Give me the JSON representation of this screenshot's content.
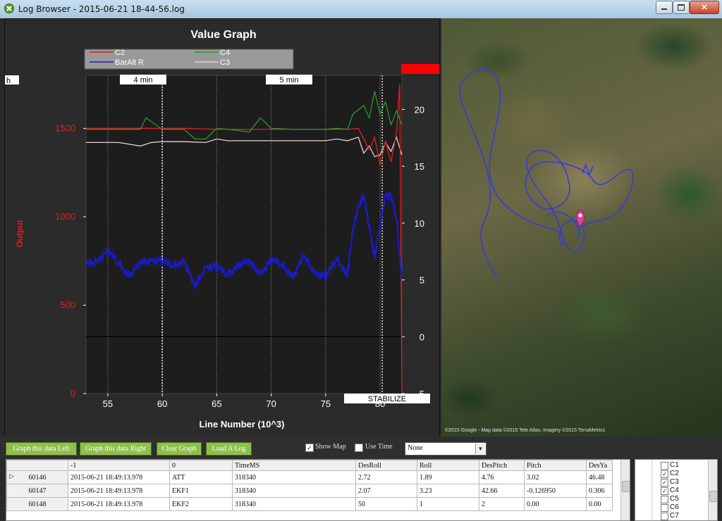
{
  "window": {
    "title": "Log Browser - 2015-06-21 18-44-56.log"
  },
  "graph": {
    "title": "Value Graph",
    "xlabel": "Line Number (10^3)",
    "ylabel": "Output",
    "legend": [
      "C2",
      "C4",
      "BarAlt R",
      "C3"
    ],
    "legend_colors": [
      "#e02020",
      "#2a9a2a",
      "#1a1acc",
      "#e8d0d0"
    ],
    "x_ticks": [
      "55",
      "60",
      "65",
      "70",
      "75",
      "80"
    ],
    "left_ticks": [
      "0",
      "500",
      "1000",
      "1500"
    ],
    "right_ticks": [
      "-5",
      "0",
      "5",
      "10",
      "15",
      "20"
    ],
    "time_markers": [
      "4 min",
      "5 min"
    ],
    "left_edge_label": "h",
    "mode_label": "STABILIZE",
    "mode_color": "#ff0000"
  },
  "chart_data": {
    "type": "line",
    "title": "Value Graph",
    "xlabel": "Line Number (10^3)",
    "ylabel": "Output",
    "xlim": [
      53,
      82
    ],
    "ylim_left": [
      0,
      1800
    ],
    "ylim_right": [
      -5,
      23
    ],
    "series": [
      {
        "name": "C2",
        "axis": "left",
        "x": [
          53,
          55,
          59,
          60,
          62,
          65,
          70,
          75,
          76,
          77,
          78,
          79,
          79.5,
          80,
          80.5,
          81,
          81.5,
          81.8,
          82
        ],
        "values": [
          1500,
          1500,
          1500,
          1500,
          1500,
          1495,
          1495,
          1495,
          1495,
          1495,
          1500,
          1380,
          1450,
          1290,
          1430,
          1310,
          1470,
          1750,
          0
        ]
      },
      {
        "name": "C4",
        "axis": "left",
        "x": [
          53,
          56,
          58,
          58.5,
          60,
          62,
          63,
          64,
          65,
          66,
          68,
          69,
          70,
          72,
          75,
          76,
          77,
          77.5,
          78.5,
          79,
          79.5,
          80,
          80.5,
          81,
          81.5,
          82
        ],
        "values": [
          1495,
          1495,
          1495,
          1560,
          1495,
          1495,
          1440,
          1440,
          1500,
          1495,
          1480,
          1560,
          1500,
          1495,
          1495,
          1500,
          1495,
          1580,
          1630,
          1560,
          1710,
          1580,
          1650,
          1520,
          1600,
          1520
        ]
      },
      {
        "name": "BarAlt R",
        "axis": "right",
        "x": [
          53,
          54,
          55,
          56,
          57,
          58,
          59,
          60,
          61,
          62,
          63,
          64,
          65,
          66,
          67,
          68,
          69,
          70,
          71,
          72,
          73,
          74,
          75,
          76,
          77,
          77.5,
          78,
          78.5,
          79,
          79.5,
          80,
          80.5,
          81,
          81.5,
          82
        ],
        "values": [
          6.2,
          6.8,
          7.5,
          6.4,
          5.5,
          6.3,
          6.9,
          6.6,
          6.2,
          6.8,
          4.2,
          6.3,
          6.1,
          5.4,
          6.5,
          6.4,
          5.7,
          6.7,
          6.3,
          5.4,
          6.9,
          5.8,
          5.2,
          6.8,
          5.6,
          9.2,
          11.6,
          12.4,
          9.6,
          7.2,
          9.6,
          12.7,
          12.3,
          10.4,
          5.0
        ]
      },
      {
        "name": "C3",
        "axis": "left",
        "x": [
          53,
          56,
          58,
          59,
          60,
          62,
          64,
          65,
          66,
          68,
          70,
          72,
          75,
          76,
          77,
          78,
          78.5,
          79,
          79.5,
          80,
          80.5,
          81,
          81.5,
          82
        ],
        "values": [
          1420,
          1420,
          1400,
          1420,
          1425,
          1425,
          1420,
          1440,
          1430,
          1430,
          1430,
          1430,
          1430,
          1440,
          1430,
          1450,
          1360,
          1400,
          1340,
          1350,
          1420,
          1370,
          1450,
          1350
        ]
      }
    ]
  },
  "map": {
    "copyright": "©2015 Google - Map data ©2015 Tele Atlas, Imagery ©2015 TerraMetrics"
  },
  "controls": {
    "graph_left": "Graph this data Left",
    "graph_right": "Graph this data Right",
    "clear_graph": "Clear Graph",
    "load_log": "Load A Log",
    "show_map": "Show Map",
    "show_map_checked": true,
    "use_time": "Use Time",
    "use_time_checked": false,
    "map_type": "None"
  },
  "grid": {
    "columns": [
      "-1",
      "0",
      "TimeMS",
      "DesRoll",
      "Roll",
      "DesPitch",
      "Pitch",
      "DesYa"
    ],
    "rows": [
      {
        "line": "60146",
        "cells": [
          "2015-06-21 18:49:13.978",
          "ATT",
          "318340",
          "2.72",
          "1.89",
          "4.76",
          "3.02",
          "46.48"
        ],
        "current": true
      },
      {
        "line": "60147",
        "cells": [
          "2015-06-21 18:49:13.978",
          "EKF1",
          "318340",
          "2.07",
          "3.23",
          "42.66",
          "-0.126950",
          "0.306"
        ],
        "current": false
      },
      {
        "line": "60148",
        "cells": [
          "2015-06-21 18:49:13.978",
          "EKF2",
          "318340",
          "50",
          "1",
          "2",
          "0.00",
          "0.00"
        ],
        "current": false
      }
    ]
  },
  "series_list": [
    {
      "label": "C1",
      "checked": false
    },
    {
      "label": "C2",
      "checked": true
    },
    {
      "label": "C3",
      "checked": true
    },
    {
      "label": "C4",
      "checked": true
    },
    {
      "label": "C5",
      "checked": false
    },
    {
      "label": "C6",
      "checked": false
    },
    {
      "label": "C7",
      "checked": false
    }
  ]
}
